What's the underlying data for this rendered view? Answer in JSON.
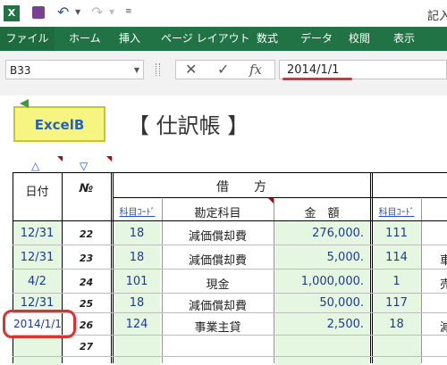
{
  "window": {
    "title": "記入"
  },
  "ribbon": {
    "tabs": [
      "ファイル",
      "ホーム",
      "挿入",
      "ページ レイアウト",
      "数式",
      "データ",
      "校閲",
      "表示"
    ]
  },
  "formula_bar": {
    "name_box": "B33",
    "fx_label": "fx",
    "formula": "2014/1/1"
  },
  "sheet": {
    "logo": "ExcelB",
    "title": "【 仕訳帳 】",
    "headers": {
      "date": "日付",
      "no": "№",
      "debit": "借　　方",
      "code": "科目ｺｰﾄﾞ",
      "account": "勘定科目",
      "amount": "金　額",
      "code2": "科目ｺｰﾄﾞ"
    },
    "rows": [
      {
        "date": "12/31",
        "no": "22",
        "code": "18",
        "account": "減価償却費",
        "amount": "276,000.",
        "code2": "111"
      },
      {
        "date": "12/31",
        "no": "23",
        "code": "18",
        "account": "減価償却費",
        "amount": "5,000.",
        "code2": "114"
      },
      {
        "date": "4/2",
        "no": "24",
        "code": "101",
        "account": "現金",
        "amount": "1,000,000.",
        "code2": "1"
      },
      {
        "date": "12/31",
        "no": "25",
        "code": "18",
        "account": "減価償却費",
        "amount": "50,000.",
        "code2": "117"
      },
      {
        "date": "2014/1/1",
        "no": "26",
        "code": "124",
        "account": "事業主貸",
        "amount": "2,500.",
        "code2": "18"
      },
      {
        "date": "",
        "no": "27",
        "code": "",
        "account": "",
        "amount": "",
        "code2": ""
      }
    ]
  }
}
